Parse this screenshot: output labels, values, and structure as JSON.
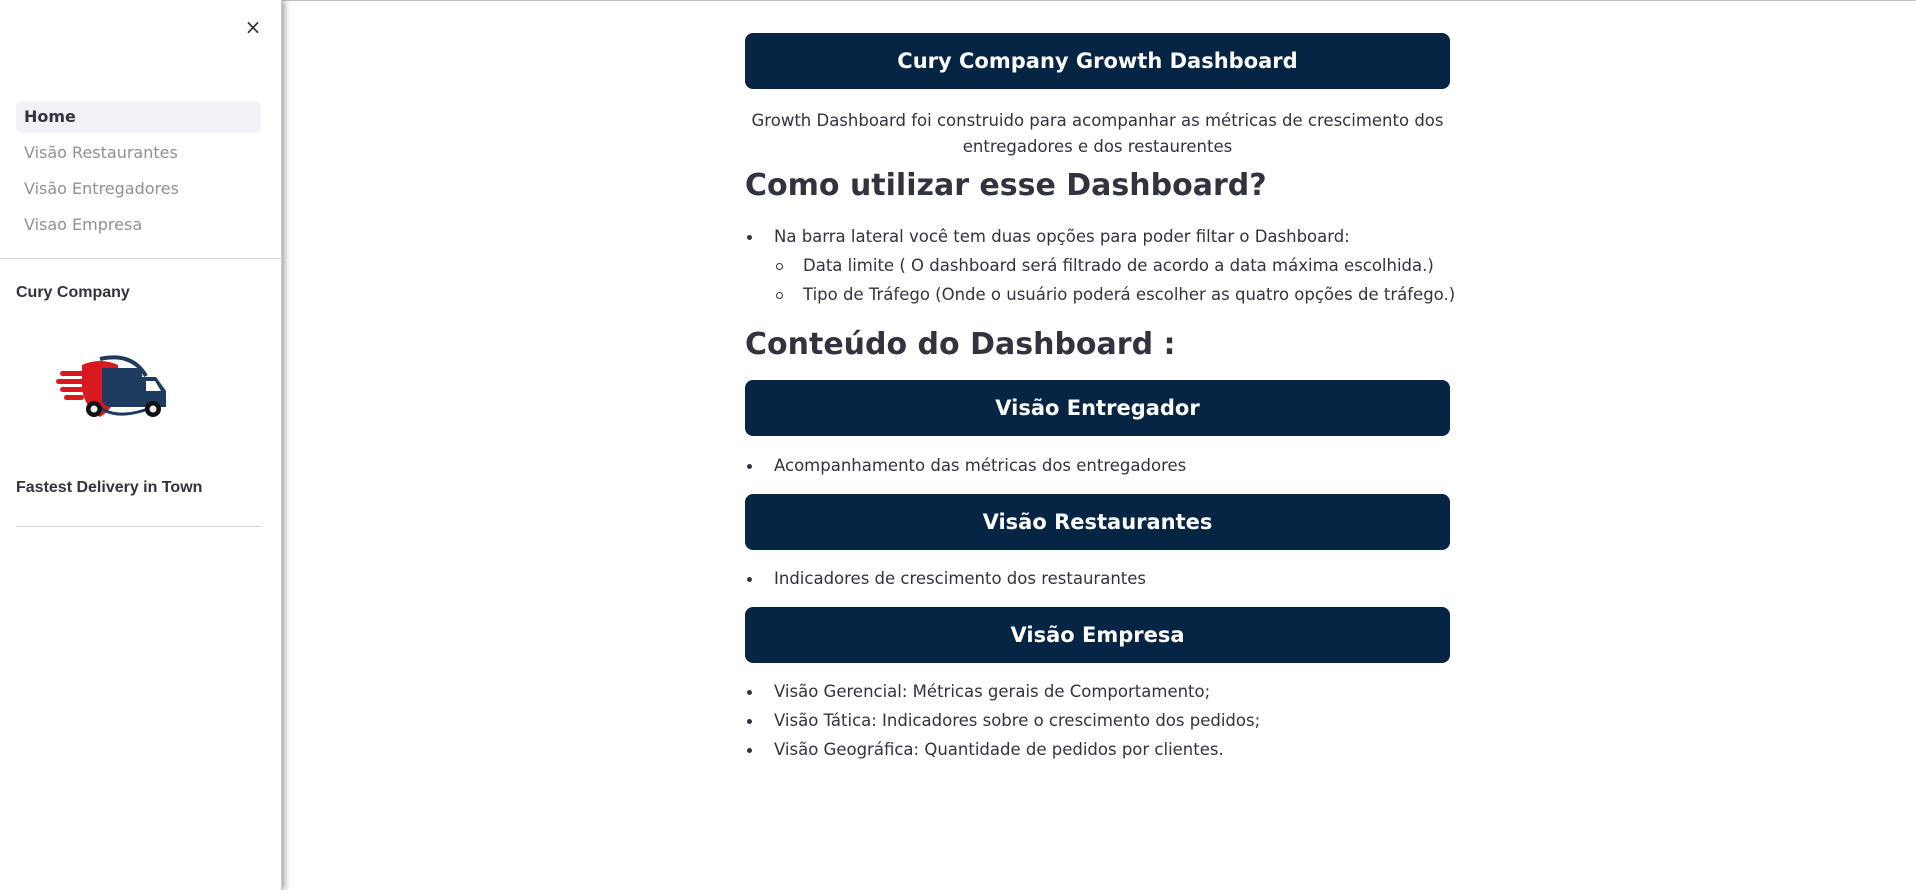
{
  "sidebar": {
    "close_label": "×",
    "nav": [
      {
        "label": "Home",
        "active": true
      },
      {
        "label": "Visão Restaurantes",
        "active": false
      },
      {
        "label": "Visão Entregadores",
        "active": false
      },
      {
        "label": "Visao Empresa",
        "active": false
      }
    ],
    "company_name": "Cury Company",
    "tagline": "Fastest Delivery in Town",
    "logo_icon": "delivery-truck-icon"
  },
  "main": {
    "title": "Cury Company Growth Dashboard",
    "intro_line1": "Growth Dashboard foi construido para acompanhar as métricas de crescimento dos",
    "intro_line2": "entregadores e dos restaurentes",
    "how_to_heading": "Como utilizar esse Dashboard?",
    "how_to_item": "Na barra lateral você tem duas opções para poder filtar o Dashboard:",
    "how_to_subitems": [
      "Data limite ( O dashboard será filtrado de acordo a data máxima escolhida.)",
      "Tipo de Tráfego (Onde o usuário poderá escolher as quatro opções de tráfego.)"
    ],
    "content_heading": "Conteúdo do Dashboard :",
    "sections": [
      {
        "title": "Visão Entregador",
        "items": [
          "Acompanhamento das métricas dos entregadores"
        ]
      },
      {
        "title": "Visão Restaurantes",
        "items": [
          "Indicadores de crescimento dos restaurantes"
        ]
      },
      {
        "title": "Visão Empresa",
        "items": [
          "Visão Gerencial: Métricas gerais de Comportamento;",
          "Visão Tática: Indicadores sobre o crescimento dos pedidos;",
          "Visão Geográfica: Quantidade de pedidos por clientes."
        ]
      }
    ]
  },
  "colors": {
    "banner": "#062443",
    "banner_text": "#ffffff",
    "text": "#31333f",
    "nav_inactive": "#8e9096",
    "nav_active_bg": "#f0f2f6",
    "logo_red": "#d71920",
    "logo_navy": "#1f3a5f"
  }
}
